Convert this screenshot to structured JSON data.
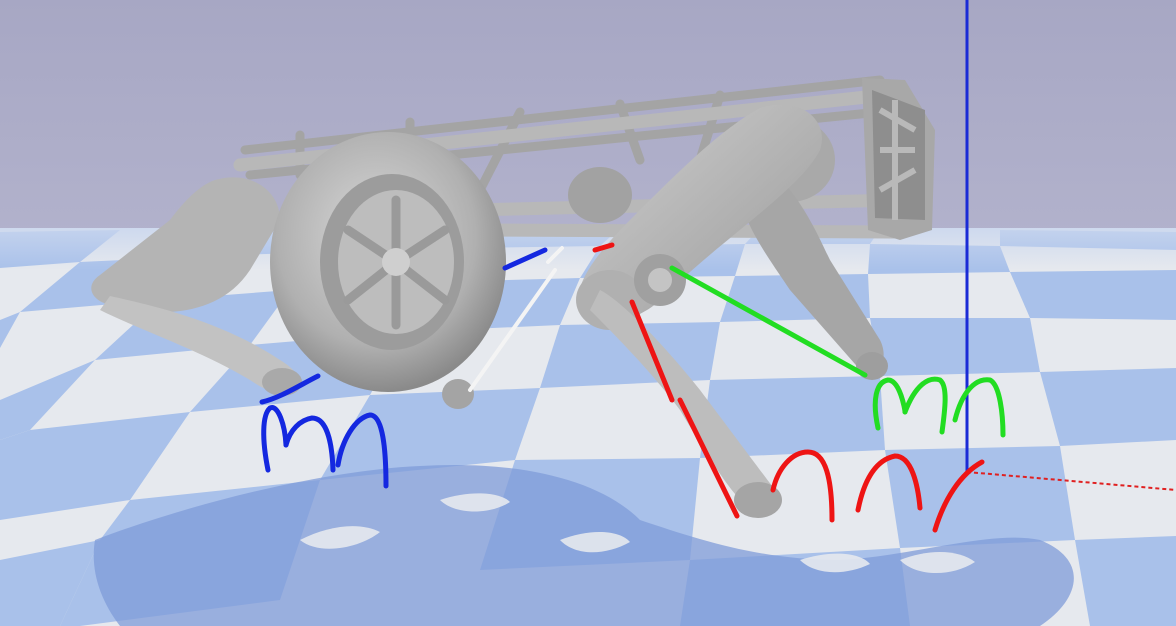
{
  "colors": {
    "sky": "#a9a9c6",
    "floor_light": "#e6e9ee",
    "floor_dark": "#a7c0ea",
    "shadow": "#7f9bd3",
    "robot_body": "#b3b3b3",
    "robot_dark": "#8d8d8d",
    "robot_light": "#d3d3d3",
    "trajectory_front_left": "#1428e0",
    "trajectory_front_right": "#22dd22",
    "trajectory_rear_right": "#ee1414",
    "trajectory_rear_left": "#f4f4f4",
    "axis_vertical": "#1a2bd6",
    "axis_horizontal": "#e02020"
  },
  "icons": {
    "robot": "quadruped-robot-icon",
    "wheel": "wheel-icon",
    "axis": "world-axis-icon"
  }
}
